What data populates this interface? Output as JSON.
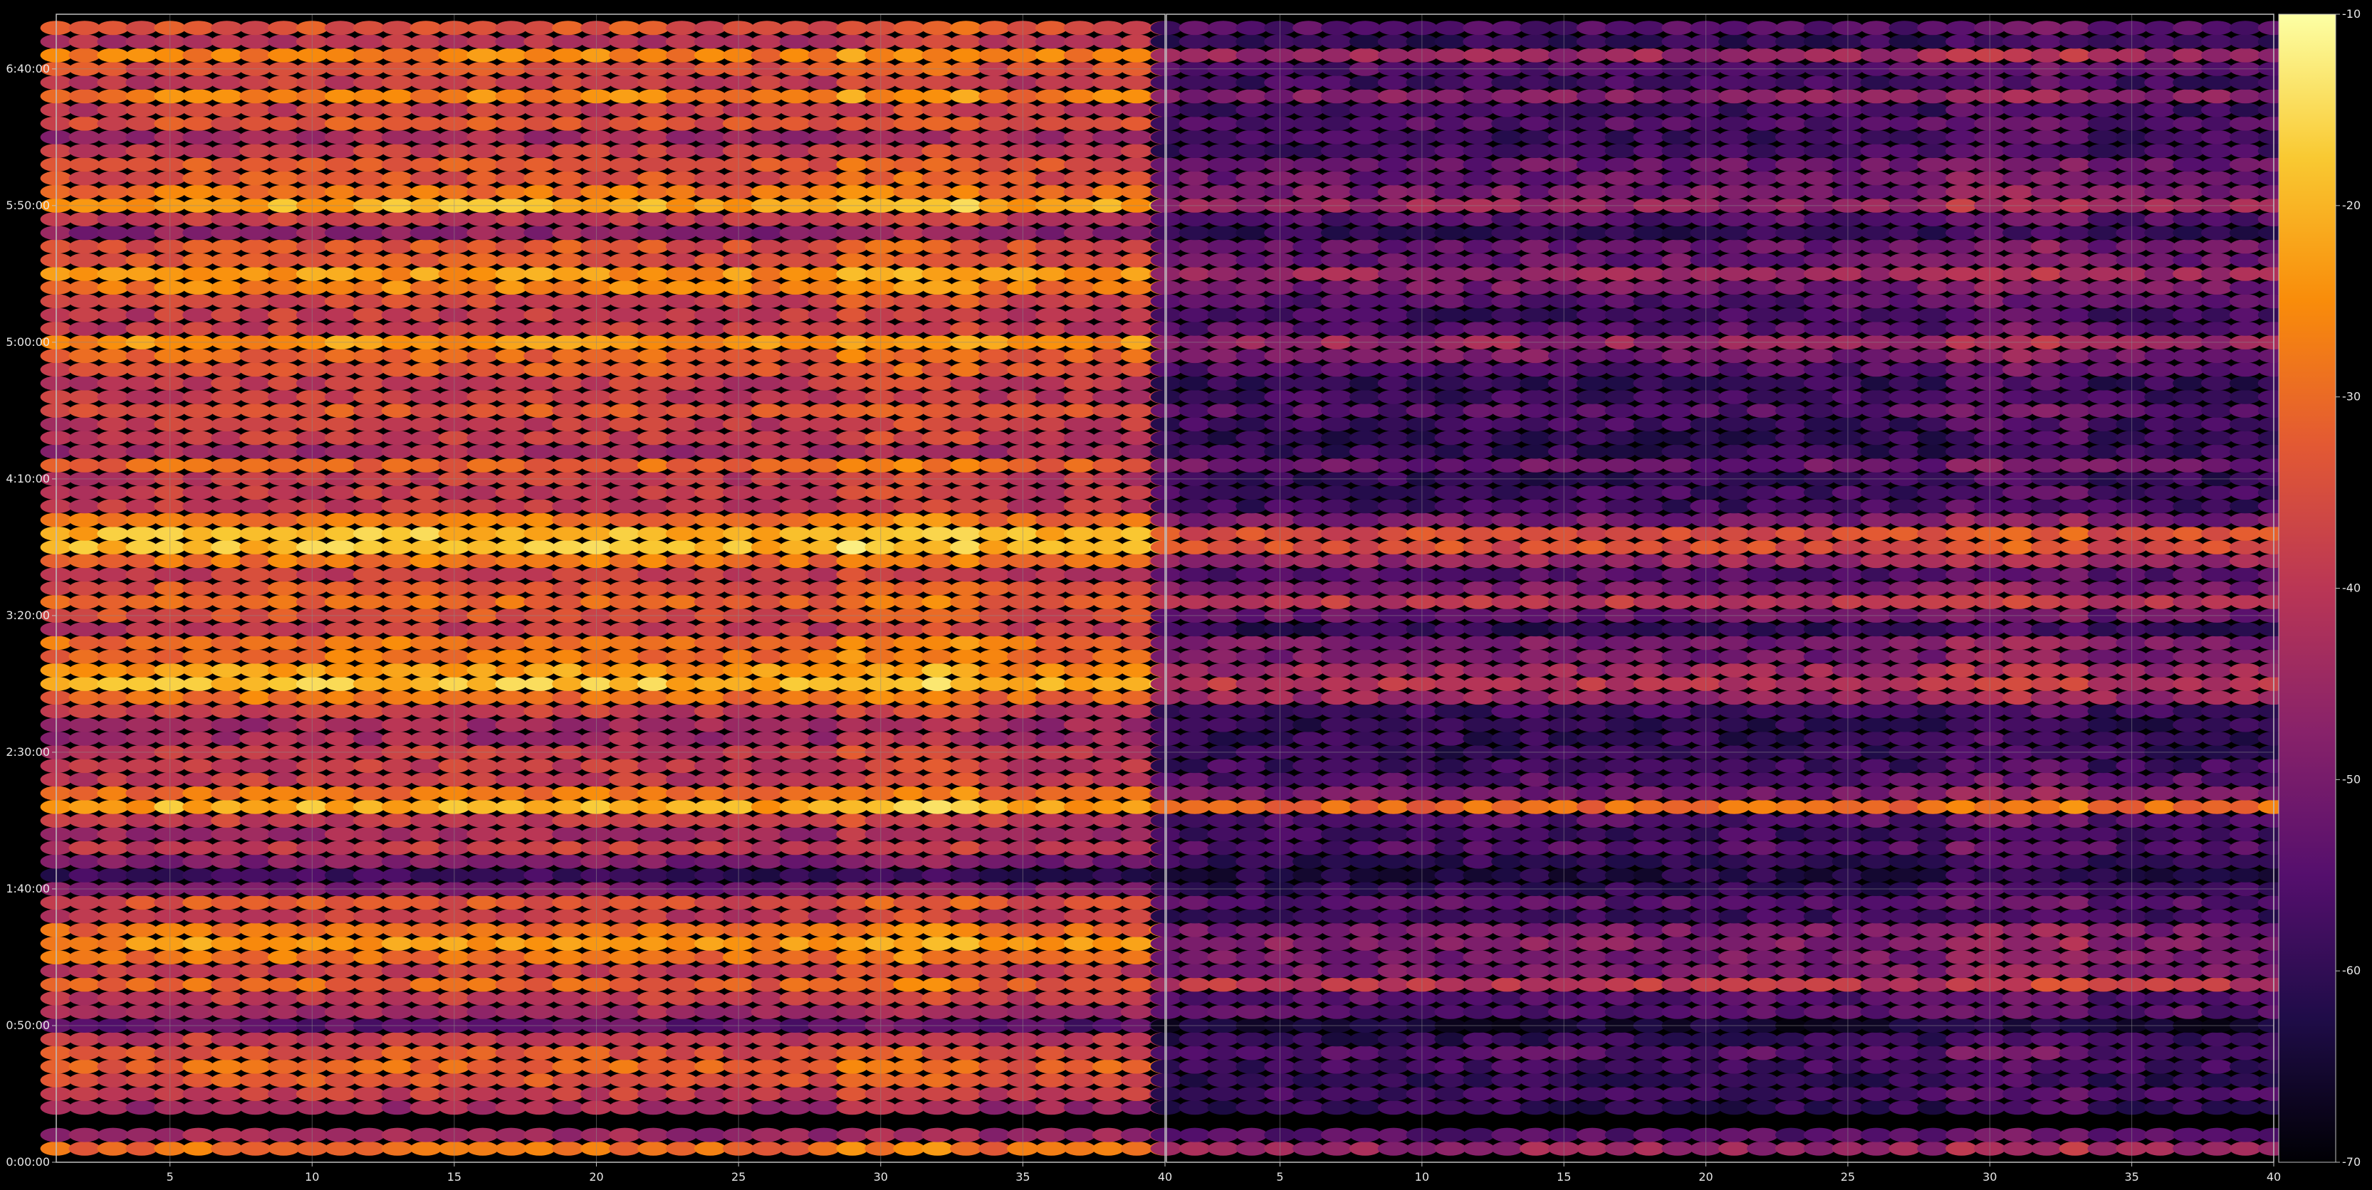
{
  "chart_data": {
    "type": "heatmap",
    "title": "",
    "xlabel": "",
    "ylabel": "",
    "panels": [
      {
        "name": "",
        "xlim": [
          1,
          40
        ],
        "xticks": [
          5,
          10,
          15,
          20,
          25,
          30,
          35,
          40
        ]
      },
      {
        "name": "",
        "xlim": [
          1,
          40
        ],
        "xticks": [
          5,
          10,
          15,
          20,
          25,
          30,
          35,
          40
        ]
      }
    ],
    "ylim_seconds": [
      0,
      25200
    ],
    "yticks": [
      {
        "value": 0,
        "label": "0:00:00"
      },
      {
        "value": 3000,
        "label": "0:50:00"
      },
      {
        "value": 6000,
        "label": "1:40:00"
      },
      {
        "value": 9000,
        "label": "2:30:00"
      },
      {
        "value": 12000,
        "label": "3:20:00"
      },
      {
        "value": 15000,
        "label": "4:10:00"
      },
      {
        "value": 18000,
        "label": "5:00:00"
      },
      {
        "value": 21000,
        "label": "5:50:00"
      },
      {
        "value": 24000,
        "label": "6:40:00"
      }
    ],
    "colorbar": {
      "colormap": "inferno",
      "range": [
        -70,
        -10
      ],
      "ticks": [
        {
          "value": -10,
          "label": "-10"
        },
        {
          "value": -20,
          "label": "-20"
        },
        {
          "value": -30,
          "label": "-30"
        },
        {
          "value": -40,
          "label": "-40"
        },
        {
          "value": -50,
          "label": "-50"
        },
        {
          "value": -60,
          "label": "-60"
        },
        {
          "value": -70,
          "label": "-70"
        }
      ]
    },
    "grid": true,
    "colors": {
      "background": "#000000",
      "grid": "#8a8a8a",
      "axis": "#bfbfbf",
      "text": "#e6e6e6"
    },
    "time_rows_seconds": [
      300,
      600,
      1200,
      1500,
      1800,
      2100,
      2400,
      2700,
      3000,
      3300,
      3600,
      3900,
      4200,
      4500,
      4800,
      5100,
      5400,
      5700,
      6000,
      6300,
      6600,
      6900,
      7200,
      7500,
      7800,
      8100,
      8400,
      8700,
      9000,
      9300,
      9600,
      9900,
      10200,
      10500,
      10800,
      11100,
      11400,
      11700,
      12000,
      12300,
      12600,
      12900,
      13200,
      13500,
      13800,
      14100,
      14400,
      14700,
      15000,
      15300,
      15600,
      15900,
      16200,
      16500,
      16800,
      17100,
      17400,
      17700,
      18000,
      18300,
      18600,
      18900,
      19200,
      19500,
      19800,
      20100,
      20400,
      20700,
      21000,
      21300,
      21600,
      21900,
      22200,
      22500,
      22800,
      23100,
      23400,
      23700,
      24000,
      24300,
      24600,
      24900
    ],
    "row_levels_left": [
      -30,
      -45,
      -45,
      -40,
      -35,
      -32,
      -35,
      -40,
      -55,
      -45,
      -40,
      -32,
      -40,
      -30,
      -25,
      -30,
      -40,
      -35,
      -50,
      -60,
      -50,
      -40,
      -45,
      -40,
      -22,
      -30,
      -40,
      -40,
      -40,
      -45,
      -45,
      -40,
      -30,
      -20,
      -25,
      -30,
      -30,
      -40,
      -35,
      -32,
      -35,
      -40,
      -30,
      -20,
      -20,
      -30,
      -40,
      -40,
      -40,
      -32,
      -45,
      -40,
      -40,
      -35,
      -40,
      -40,
      -35,
      -32,
      -25,
      -40,
      -40,
      -38,
      -28,
      -25,
      -35,
      -35,
      -48,
      -40,
      -22,
      -30,
      -35,
      -35,
      -40,
      -45,
      -35,
      -40,
      -28,
      -40,
      -35,
      -28,
      -42,
      -35
    ],
    "row_levels_right": [
      -45,
      -55,
      -60,
      -58,
      -60,
      -58,
      -55,
      -60,
      -65,
      -55,
      -55,
      -40,
      -50,
      -50,
      -48,
      -50,
      -58,
      -55,
      -60,
      -62,
      -60,
      -55,
      -58,
      -55,
      -30,
      -50,
      -55,
      -58,
      -60,
      -60,
      -60,
      -58,
      -45,
      -40,
      -45,
      -50,
      -50,
      -60,
      -52,
      -40,
      -50,
      -55,
      -45,
      -35,
      -35,
      -50,
      -58,
      -58,
      -60,
      -52,
      -60,
      -60,
      -58,
      -55,
      -58,
      -60,
      -55,
      -50,
      -45,
      -55,
      -58,
      -55,
      -50,
      -45,
      -52,
      -52,
      -60,
      -55,
      -45,
      -50,
      -52,
      -52,
      -58,
      -58,
      -55,
      -58,
      -48,
      -58,
      -55,
      -45,
      -60,
      -55
    ]
  }
}
